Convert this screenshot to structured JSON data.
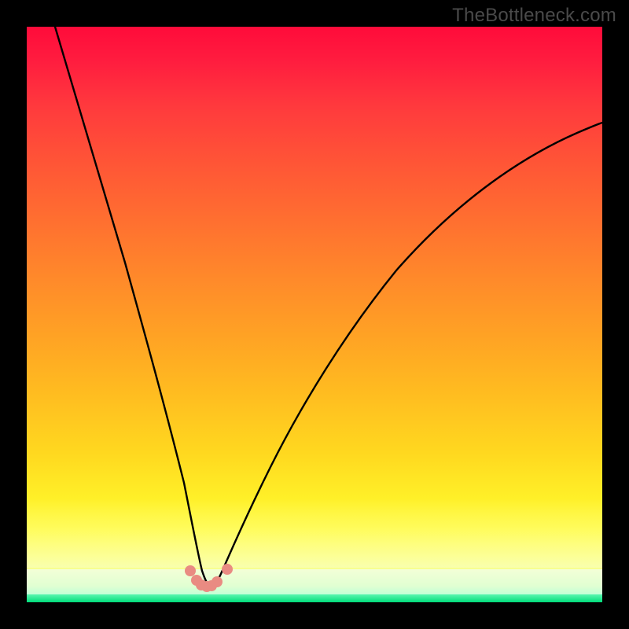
{
  "watermark": "TheBottleneck.com",
  "chart_data": {
    "type": "line",
    "title": "",
    "xlabel": "",
    "ylabel": "",
    "xlim": [
      0,
      100
    ],
    "ylim": [
      0,
      100
    ],
    "series": [
      {
        "name": "bottleneck-curve",
        "x": [
          5,
          8,
          12,
          16,
          20,
          23,
          25,
          27,
          29,
          30,
          31,
          32,
          33,
          35,
          38,
          42,
          48,
          56,
          66,
          78,
          90,
          100
        ],
        "y": [
          100,
          88,
          74,
          60,
          44,
          30,
          20,
          12,
          6,
          4,
          3,
          3,
          4,
          6,
          10,
          18,
          30,
          44,
          58,
          70,
          78,
          83
        ]
      }
    ],
    "markers": {
      "name": "salmon-dots",
      "color": "#e98b82",
      "points": [
        {
          "x": 28.5,
          "y": 5.5
        },
        {
          "x": 29.5,
          "y": 3.8
        },
        {
          "x": 30.3,
          "y": 3.0
        },
        {
          "x": 31.2,
          "y": 2.8
        },
        {
          "x": 32.0,
          "y": 3.0
        },
        {
          "x": 33.0,
          "y": 3.6
        },
        {
          "x": 34.8,
          "y": 5.8
        }
      ]
    },
    "background_gradient": {
      "top": "#ff0b3a",
      "mid": "#ffbd20",
      "low": "#fdff73",
      "bottom": "#00dd7a"
    }
  }
}
